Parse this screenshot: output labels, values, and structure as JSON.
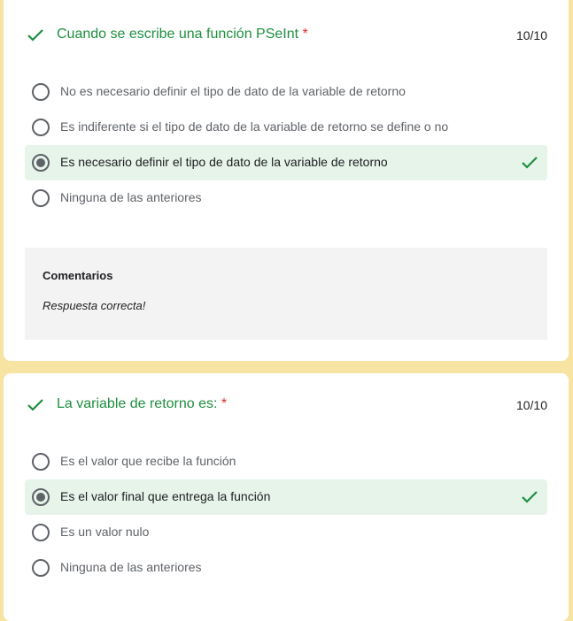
{
  "questions": [
    {
      "title": "Cuando se escribe una función PSeInt",
      "required_marker": "*",
      "score": "10/10",
      "options": [
        {
          "label": "No es necesario definir el tipo de dato de la variable de retorno",
          "selected": false,
          "correct": false
        },
        {
          "label": "Es indiferente si el tipo de dato de la variable de retorno se define o no",
          "selected": false,
          "correct": false
        },
        {
          "label": "Es necesario definir el tipo de dato de la variable de retorno",
          "selected": true,
          "correct": true
        },
        {
          "label": "Ninguna de las anteriores",
          "selected": false,
          "correct": false
        }
      ],
      "feedback": {
        "title": "Comentarios",
        "text": "Respuesta correcta!"
      }
    },
    {
      "title": "La variable de retorno es:",
      "required_marker": "*",
      "score": "10/10",
      "options": [
        {
          "label": "Es el valor que recibe la función",
          "selected": false,
          "correct": false
        },
        {
          "label": "Es el valor final que entrega la función",
          "selected": true,
          "correct": true
        },
        {
          "label": "Es un valor nulo",
          "selected": false,
          "correct": false
        },
        {
          "label": "Ninguna de las anteriores",
          "selected": false,
          "correct": false
        }
      ]
    }
  ],
  "colors": {
    "page_background": "#f7e4a3",
    "correct_green": "#1e8e3e",
    "correct_highlight": "#e6f4ea",
    "required_red": "#d93025",
    "feedback_background": "#f3f3f3"
  },
  "icons": {
    "question_status": "check-icon",
    "correct_option": "check-icon"
  }
}
